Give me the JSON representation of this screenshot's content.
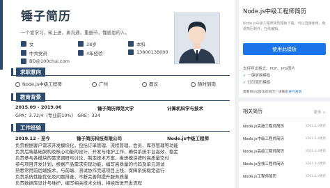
{
  "resume": {
    "name": "锤子简历",
    "tagline": "一个爱学习，知上进，勇沟通，重细节，懂感恩的人。",
    "info": {
      "gender": "女",
      "age": "28岁",
      "education": "本科",
      "party": "中共党员",
      "experience": "4年经验",
      "phone": "13800138000",
      "email": "BD@100chui.com"
    },
    "intent": {
      "title": "求职意向",
      "job": "Node.js中级工程师",
      "city": "广州",
      "salary": "面议",
      "availability": "随时到岗"
    },
    "education": {
      "title": "教育背景",
      "period": "2015.09 - 2019.06",
      "school": "锤子简历师范大学",
      "major": "计算机科学与技术",
      "gpa": "GPA：3.72/4（专业前10%） GRE：324"
    },
    "work": {
      "title": "工作经验",
      "period": "2019.12 - 至今",
      "company": "锤子简历科技有限公司",
      "role": "Node.js中级工程师",
      "bullets": [
        "负责根据客户需求开发模块化，包括订单管理、流程管理、会员、库存管理等功能",
        "负责后端基础架构及核心功能的设计、开发与维护工作，确保系统平台高效、稳定",
        "负责参与各模块的需求调研与讨论，制定技术方案，推进模块按时高质量交付",
        "参与项目开发计划，根据产品需求实现功能，编写高质量的代码及单元测试",
        "熟悉常用前后端技术，与前端、测试协作完成项目上线，保障系统稳定运行",
        "负责系统性能优化及问题排查，不断完善和提升服务质量",
        "负责数据库设计与维护，编写相关技术文档，持续改进开发流程"
      ]
    }
  },
  "sidebar": {
    "template_title": "Node.js中级工程师简历",
    "template_desc": "Node.js中级工程师简历模板下载，可以直接使用，免费简历制作，在线编辑。",
    "use_button": "使用此模板",
    "support_formats": "支持导出格式：PDF、JPG图片",
    "one_click": "一键更换模板",
    "print": "打印简历模板",
    "help_prefix": "需要Word版本的简历？请联系",
    "help_link": "进行咨询",
    "related_title": "相关简历",
    "more": "更多 >",
    "related": [
      {
        "name": "Node.js实施工程师简历",
        "date": "2021.1.4更新"
      },
      {
        "name": "Node.js中级工程师简历",
        "date": "2021.1.4更新"
      },
      {
        "name": "Node.js高级工程师简历",
        "date": "2021.1.4更新"
      },
      {
        "name": "Node.js全栈工程师简历",
        "date": "2021.1.4更新"
      },
      {
        "name": "Node.js工程师简历",
        "date": "2021.1.4更新"
      }
    ]
  }
}
